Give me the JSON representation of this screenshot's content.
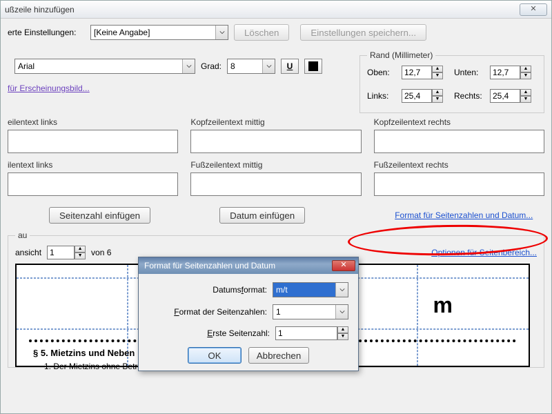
{
  "title": "ußzeile hinzufügen",
  "settings": {
    "label": "erte Einstellungen:",
    "value": "[Keine Angabe]",
    "delete": "Löschen",
    "save": "Einstellungen speichern..."
  },
  "font": {
    "name": "Arial",
    "size_label": "Grad:",
    "size": "8"
  },
  "appearance_link": "für Erscheinungsbild...",
  "margins": {
    "legend": "Rand (Millimeter)",
    "top_l": "Oben:",
    "top": "12,7",
    "bottom_l": "Unten:",
    "bottom": "12,7",
    "left_l": "Links:",
    "left": "25,4",
    "right_l": "Rechts:",
    "right": "25,4"
  },
  "headers": {
    "hl": "eilentext links",
    "hc": "Kopfzeilentext mittig",
    "hr": "Kopfzeilentext rechts",
    "fl": "ilentext links",
    "fc": "Fußzeilentext mittig",
    "fr": "Fußzeilentext rechts"
  },
  "insert": {
    "page": "Seitenzahl einfügen",
    "date": "Datum einfügen",
    "format_link": "Format für Seitenzahlen und Datum..."
  },
  "preview": {
    "legend": "au",
    "view_l": "ansicht",
    "page": "1",
    "of": "von 6",
    "range_link": "Optionen für Seitenbereich...",
    "doc_heading": "§ 5.   Mietzins und Neben",
    "doc_line": "1.    Der Mietzins ohne Betriebskosten beträgt monatlich",
    "big_m": "m"
  },
  "modal": {
    "title": "Format für Seitenzahlen und Datum",
    "date_fmt_l": "Datumsformat:",
    "date_fmt": "m/t",
    "pagenum_fmt_l": "Format der Seitenzahlen:",
    "pagenum_fmt": "1",
    "first_page_l": "Erste Seitenzahl:",
    "first_page": "1",
    "ok": "OK",
    "cancel": "Abbrechen"
  }
}
